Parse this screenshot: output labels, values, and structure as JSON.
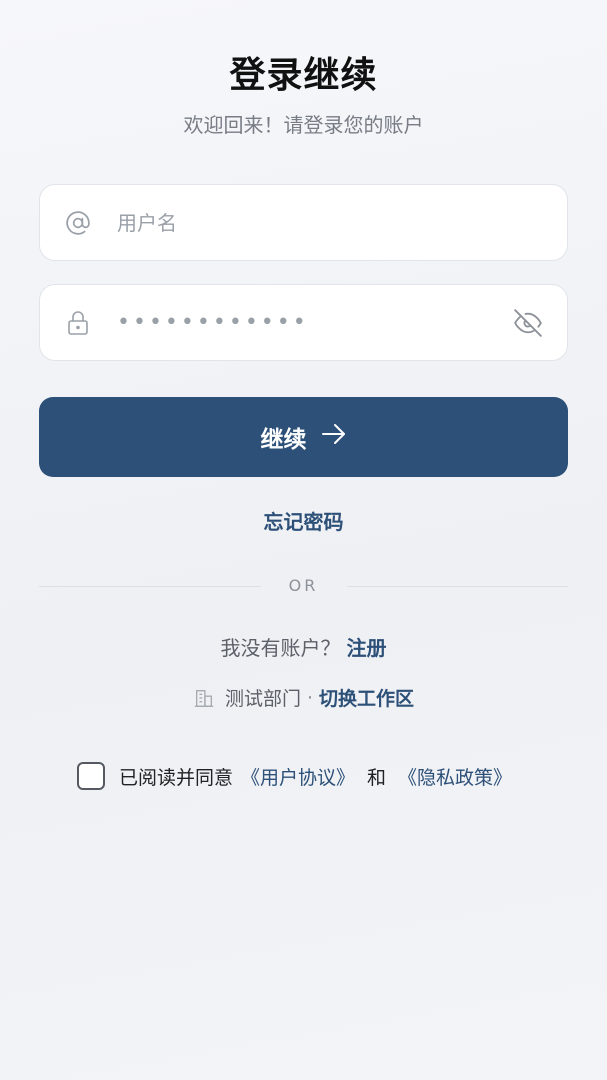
{
  "header": {
    "title": "登录继续",
    "subtitle": "欢迎回来！请登录您的账户"
  },
  "form": {
    "username_placeholder": "用户名",
    "username_value": "",
    "password_masked": "••••••••••••",
    "continue_label": "继续",
    "forgot_label": "忘记密码"
  },
  "divider": {
    "label": "OR"
  },
  "signup": {
    "prompt": "我没有账户？",
    "link": "注册"
  },
  "workspace": {
    "name": "测试部门",
    "separator": "·",
    "switch_label": "切换工作区"
  },
  "agreement": {
    "prefix": "已阅读并同意",
    "user_agreement": "《用户协议》",
    "conjunction": "和",
    "privacy_policy": "《隐私政策》",
    "checked": false
  },
  "colors": {
    "primary": "#2d5078",
    "background": "#f3f4f7"
  },
  "icons": {
    "username": "at-icon",
    "password": "lock-icon",
    "visibility": "eye-off-icon",
    "continue": "arrow-right-icon",
    "workspace": "building-icon"
  }
}
